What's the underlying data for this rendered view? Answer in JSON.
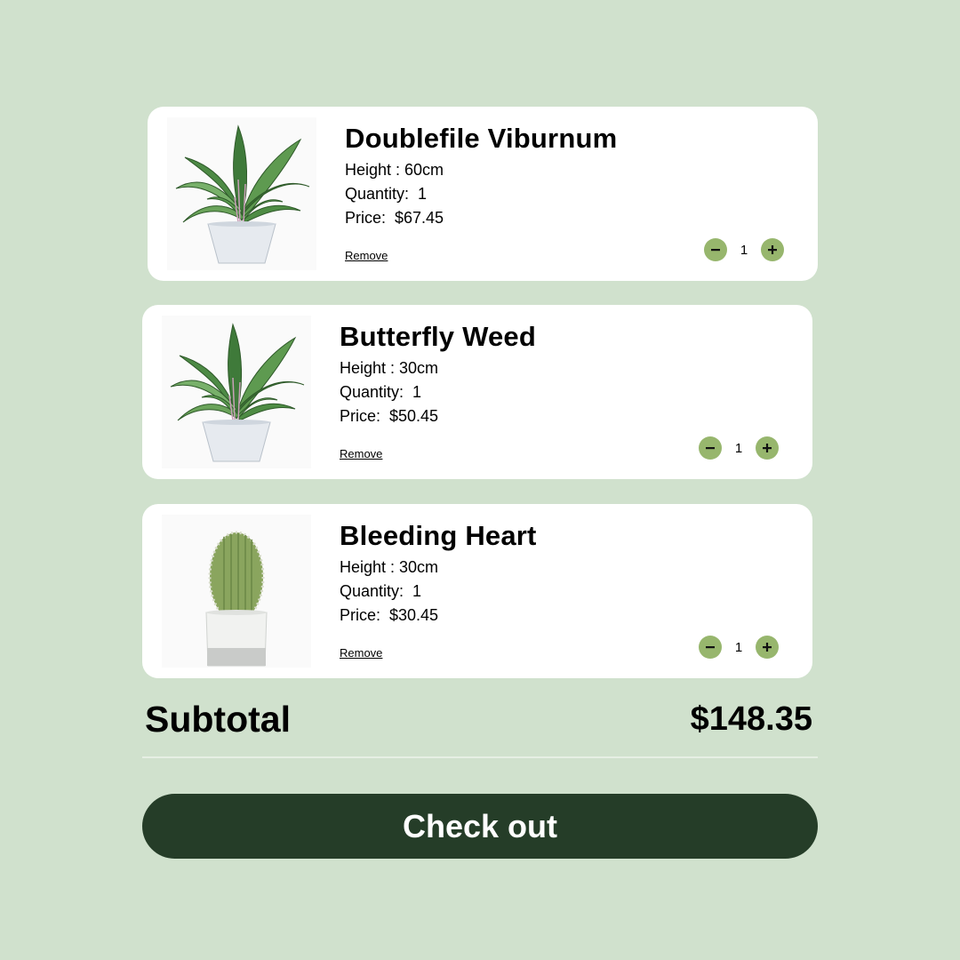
{
  "cart": {
    "items": [
      {
        "name": "Doublefile Viburnum",
        "height": "Height : 60cm",
        "quantity": "Quantity:  1",
        "price": "Price:  $67.45",
        "remove_label": "Remove",
        "stepper_qty": "1",
        "image": "potted-leafy-plant"
      },
      {
        "name": "Butterfly Weed",
        "height": "Height : 30cm",
        "quantity": "Quantity:  1",
        "price": "Price:  $50.45",
        "remove_label": "Remove",
        "stepper_qty": "1",
        "image": "potted-leafy-plant"
      },
      {
        "name": "Bleeding Heart",
        "height": "Height : 30cm",
        "quantity": "Quantity:  1",
        "price": "Price:  $30.45",
        "remove_label": "Remove",
        "stepper_qty": "1",
        "image": "potted-cactus"
      }
    ]
  },
  "summary": {
    "subtotal_label": "Subtotal",
    "subtotal_value": "$148.35",
    "checkout_label": "Check out"
  },
  "colors": {
    "background": "#d0e1cd",
    "card": "#ffffff",
    "stepper_button": "#97b66d",
    "checkout_button": "#253d28"
  },
  "icons": {
    "decrement": "minus-icon",
    "increment": "plus-icon"
  }
}
